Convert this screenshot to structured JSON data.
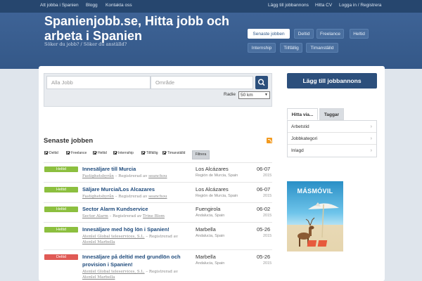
{
  "topnav": {
    "left": [
      "Att jobba i Spanien",
      "Blogg",
      "Kontakta oss"
    ],
    "right": [
      "Lägg till jobbannons",
      "Hitta CV",
      "Logga in / Registrera"
    ]
  },
  "header": {
    "title": "Spanienjobb.se, Hitta jobb och arbeta i Spanien",
    "subtitle": "Söker du jobb? / Söker du anställd?",
    "tabs": [
      "Senaste jobben",
      "Deltid",
      "Freelance",
      "Heltid",
      "Internship",
      "Tillfällig",
      "Timanställd"
    ],
    "active_tab": "Senaste jobben"
  },
  "search": {
    "keyword_placeholder": "Alla Jobb",
    "area_placeholder": "Område",
    "radius_label": "Radie",
    "radius_value": "50 km"
  },
  "latest": {
    "title": "Senaste jobben",
    "filters": [
      "Deltid",
      "Freelance",
      "Heltid",
      "Internship",
      "Tillfällig",
      "Timanställd"
    ],
    "filter_button": "Filtrera"
  },
  "jobs": [
    {
      "type": "Heltid",
      "title": "Innesäljare till Murcia",
      "company": "Fastighetsbyrån",
      "registered": "Registrerad av",
      "author": "seanchou",
      "city": "Los Alcázares",
      "region": "Región de Murcia, Spain",
      "date": "06-07",
      "year": "2015"
    },
    {
      "type": "Heltid",
      "title": "Säljare Murcia/Los Alcazares",
      "company": "Fastighetsbyrån",
      "registered": "Registrerad av",
      "author": "seanchou",
      "city": "Los Alcázares",
      "region": "Región de Murcia, Spain",
      "date": "06-07",
      "year": "2015"
    },
    {
      "type": "Heltid",
      "title": "Sector Alarm Kundservice",
      "company": "Sector Alarm",
      "registered": "Registrerad av",
      "author": "Trine Blom",
      "city": "Fuengirola",
      "region": "Andalucia, Spain",
      "date": "06-02",
      "year": "2015"
    },
    {
      "type": "Heltid",
      "title": "Innesäljare med hög lön i Spanien!",
      "company": "Atenlel Global teleservices, S.L.",
      "registered": "Registrerad av",
      "author": "Atenlel Marbella",
      "city": "Marbella",
      "region": "Andalucia, Spain",
      "date": "05-26",
      "year": "2015"
    },
    {
      "type": "Deltid",
      "title_line1": "Innesäljare på deltid med grundlön och",
      "title_line2": "provision i Spanien!",
      "company": "Atenlel Global teleservices, S.L.",
      "registered": "Registrerad av",
      "author": "Atenlel Marbella",
      "city": "Marbella",
      "region": "Andalucia, Spain",
      "date": "05-26",
      "year": "2015"
    }
  ],
  "sidebar": {
    "add_button": "Lägg till jobbannons",
    "tabs": [
      "Hitta via...",
      "Taggar"
    ],
    "items": [
      "Arbetstid",
      "Jobbkategori",
      "Inlagd"
    ],
    "ad_brand": "MÁSMÓVIL"
  },
  "colors": {
    "heltid": "#8cbf3f",
    "deltid": "#e05a55",
    "primary": "#2c4f7c",
    "header": "#3a5f91"
  }
}
